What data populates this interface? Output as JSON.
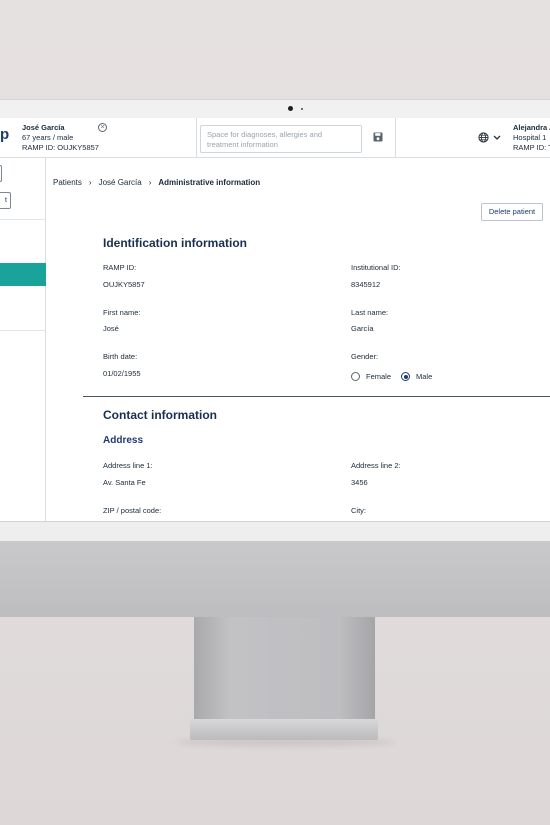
{
  "header": {
    "logo": "p",
    "patient": {
      "name": "José García",
      "age_sex": "67 years / male",
      "ramp_id": "RAMP ID: OUJKY5857"
    },
    "notes_placeholder": "Space for diagnoses, allergies and treatment information",
    "user": {
      "name": "Alejandra A",
      "hospital": "Hospital 1",
      "ramp_id": "RAMP ID: TI"
    }
  },
  "sidebar": {
    "button_label": "t"
  },
  "breadcrumb": {
    "items": [
      "Patients",
      "José García",
      "Administrative information"
    ]
  },
  "actions": {
    "delete_label": "Delete patient"
  },
  "identification": {
    "title": "Identification information",
    "ramp_id_label": "RAMP ID:",
    "ramp_id_value": "OUJKY5857",
    "institutional_id_label": "Institutional ID:",
    "institutional_id_value": "8345912",
    "first_name_label": "First name:",
    "first_name_value": "José",
    "last_name_label": "Last name:",
    "last_name_value": "García",
    "birth_date_label": "Birth date:",
    "birth_date_value": "01/02/1955",
    "gender_label": "Gender:",
    "gender_options": [
      "Female",
      "Male"
    ],
    "gender_selected": "Male"
  },
  "contact": {
    "title": "Contact information",
    "address_title": "Address",
    "address1_label": "Address line 1:",
    "address1_value": "Av. Santa Fe",
    "address2_label": "Address line 2:",
    "address2_value": "3456",
    "zip_label": "ZIP / postal code:",
    "city_label": "City:"
  },
  "colors": {
    "accent_teal": "#1aa39a",
    "primary_navy": "#1d3b73"
  }
}
